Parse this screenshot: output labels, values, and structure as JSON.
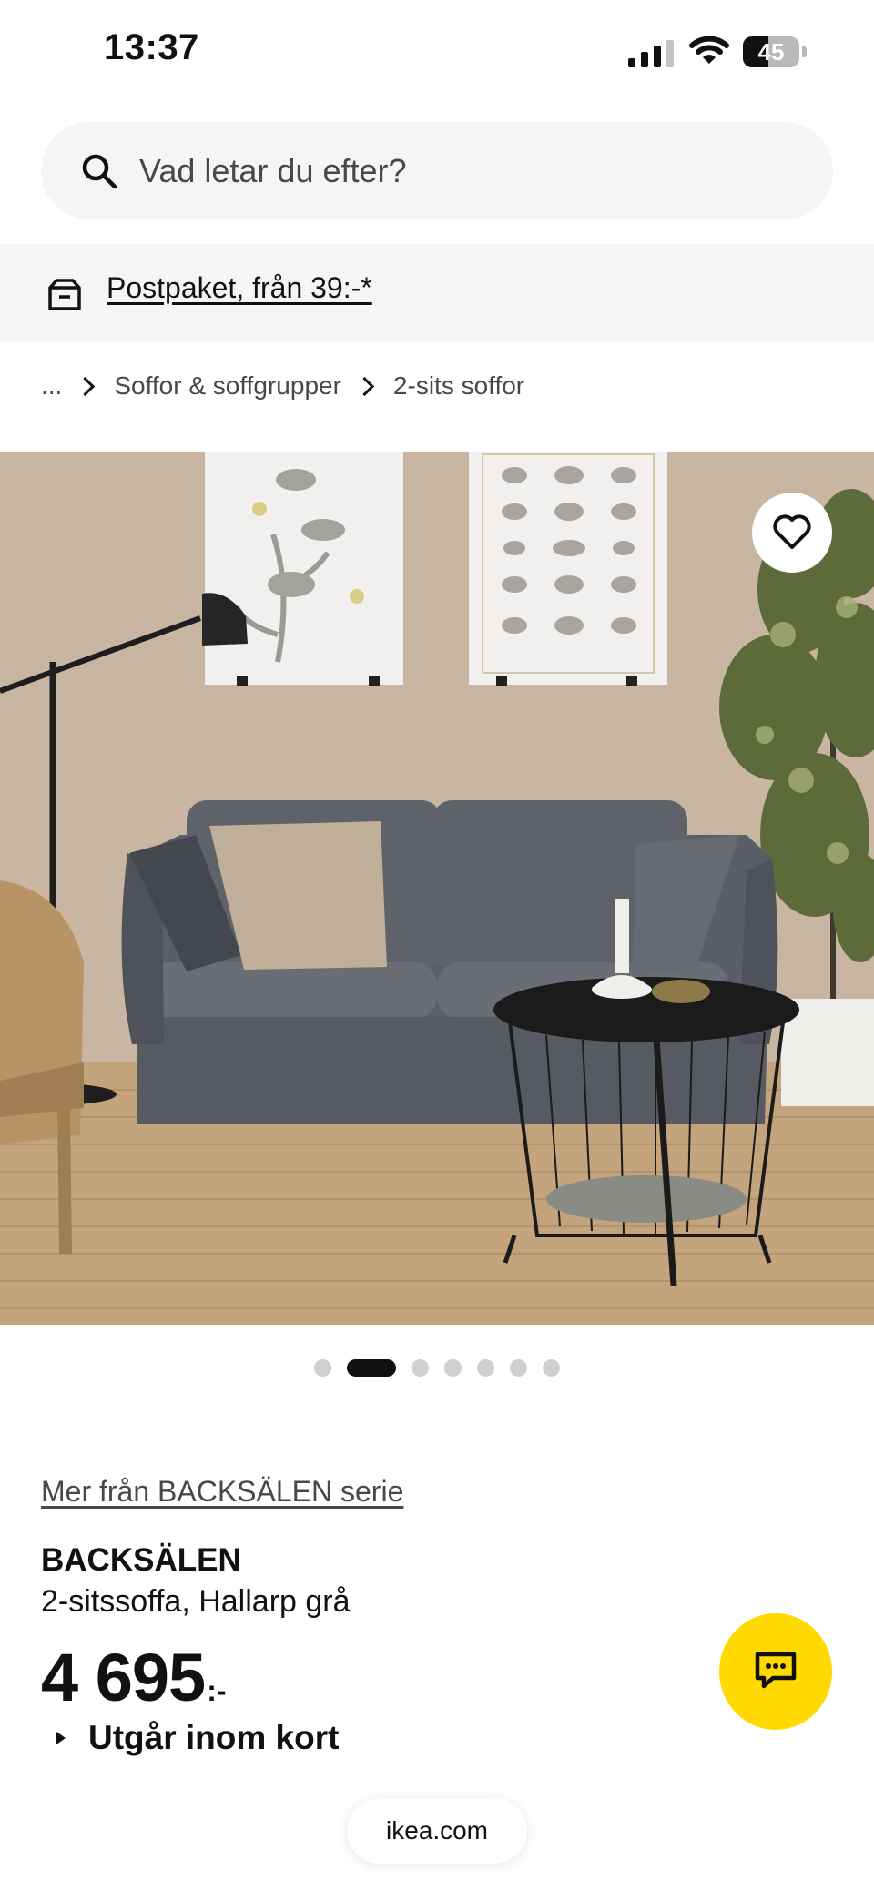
{
  "status_bar": {
    "time": "13:37",
    "battery_percent": "45",
    "battery_level": 0.45,
    "signal_icon": "cellular-signal-icon",
    "wifi_icon": "wifi-icon",
    "battery_icon": "battery-icon"
  },
  "search": {
    "placeholder": "Vad letar du efter?",
    "icon": "search-icon"
  },
  "delivery_banner": {
    "icon": "delivery-box-icon",
    "link_text": "Postpaket, från 39:-*"
  },
  "breadcrumb": {
    "items": [
      "...",
      "Soffor & soffgrupper",
      "2-sits soffor"
    ]
  },
  "gallery": {
    "favorite_icon": "heart-icon",
    "image_count": 7,
    "active_index": 1
  },
  "product": {
    "series_link": "Mer från BACKSÄLEN serie",
    "name": "BACKSÄLEN",
    "description": "2-sitssoffa, Hallarp grå",
    "price": "4 695",
    "price_suffix": ":-",
    "availability": "Utgår inom kort"
  },
  "chat": {
    "icon": "chat-icon"
  },
  "browser": {
    "url": "ikea.com"
  },
  "colors": {
    "accent_yellow": "#ffd900",
    "text_primary": "#111111",
    "text_secondary": "#484848",
    "surface_grey": "#f5f5f5"
  }
}
